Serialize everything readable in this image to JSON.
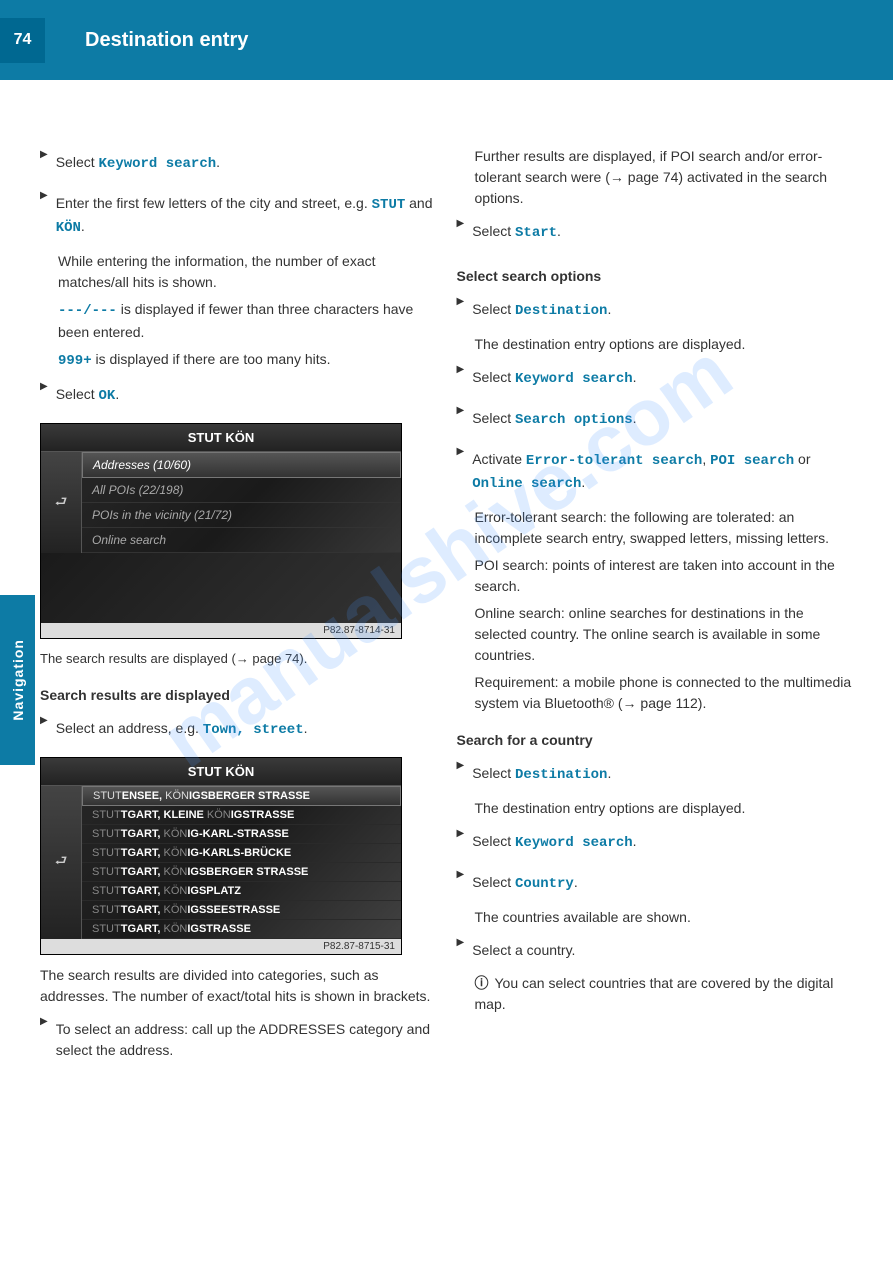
{
  "header": {
    "page_number": "74",
    "title": "Destination entry"
  },
  "side_tab": "Navigation",
  "watermark": "manualshive.com",
  "left": {
    "p1_a": "Select ",
    "p1_b": "Keyword search",
    "p1_c": ".",
    "p2_a": "Enter the first few letters of the city and street, e.g. ",
    "p2_b": "STUT",
    "p2_c": " and ",
    "p2_d": "KÖN",
    "p2_e": ".",
    "p3": "While entering the information, the number of exact matches/all hits is shown.",
    "p4_a": "---/---",
    "p4_b": " is displayed if fewer than three characters have been entered.",
    "p5_a": "999+",
    "p5_b": " is displayed if there are too many hits.",
    "p6_a": "Select ",
    "p6_b": "OK",
    "p6_c": ".",
    "caption1": "The search results are displayed (→ page 74).",
    "section1": "Search results are displayed",
    "caption2_a": "Select an address, e.g. ",
    "caption2_b": "Town, street",
    "caption2_c": "."
  },
  "right": {
    "p1": "Further results are displayed, if POI search and/or error-tolerant search were (→ page 74) activated in the search options.",
    "p2_a": "Select ",
    "p2_b": "Start",
    "p2_c": ".",
    "section2": "Select search options",
    "s2p1_a": "Select ",
    "s2p1_b": "Destination",
    "s2p1_c": ".",
    "s2p2": "The destination entry options are displayed.",
    "s2p3_a": "Select ",
    "s2p3_b": "Keyword search",
    "s2p3_c": ".",
    "s2p4_a": "Select ",
    "s2p4_b": "Search options",
    "s2p4_c": ".",
    "s2p5_a": "Activate ",
    "s2p5_b": "Error-tolerant search",
    "s2p5_c": "POI search",
    "s2p5_d": "Online search",
    "s2p5_e": ", ",
    "s2p5_f": " or ",
    "s2p5_g": ".",
    "s2p6": "Error-tolerant search: the following are tolerated: an incomplete search entry, swapped letters, missing letters.",
    "s2p7": "POI search: points of interest are taken into account in the search.",
    "s2p8": "Online search: online searches for destinations in the selected country. The online search is available in some countries.",
    "s2p9": "Requirement: a mobile phone is connected to the multimedia system via Bluetooth® (→ page 112).",
    "section3": "Search for a country",
    "s3p1_a": "Select ",
    "s3p1_b": "Destination",
    "s3p1_c": ".",
    "s3p2": "The destination entry options are displayed.",
    "s3p3_a": "Select ",
    "s3p3_b": "Keyword search",
    "s3p3_c": ".",
    "s3p4_a": "Select ",
    "s3p4_b": "Country",
    "s3p4_c": ".",
    "s3p5": "The countries available are shown.",
    "s3p6": "Select a country.",
    "s3p7": "You can select countries that are covered by the digital map."
  },
  "bottom": {
    "p1": "The search results are divided into categories, such as addresses. The number of exact/total hits is shown in brackets.",
    "p2": "To select an address: call up the ADDRESSES category and select the address."
  },
  "screenshot1": {
    "title": "STUT KÖN",
    "rows": [
      "Addresses (10/60)",
      "All POIs (22/198)",
      "POIs in the vicinity (21/72)",
      "Online search"
    ],
    "footer": "P82.87-8714-31"
  },
  "screenshot2": {
    "title": "STUT KÖN",
    "rows": [
      {
        "pre": "STUT",
        "mid": "ENSEE, KÖN",
        "post": "IGSBERGER STRASSE"
      },
      {
        "pre": "STUT",
        "mid": "TGART, KLEINE KÖN",
        "post": "IGSTRASSE"
      },
      {
        "pre": "STUT",
        "mid": "TGART, KÖN",
        "post": "IG-KARL-STRASSE"
      },
      {
        "pre": "STUT",
        "mid": "TGART, KÖN",
        "post": "IG-KARLS-BRÜCKE"
      },
      {
        "pre": "STUT",
        "mid": "TGART, KÖN",
        "post": "IGSBERGER STRASSE"
      },
      {
        "pre": "STUT",
        "mid": "TGART, KÖN",
        "post": "IGSPLATZ"
      },
      {
        "pre": "STUT",
        "mid": "TGART, KÖN",
        "post": "IGSSEESTRASSE"
      },
      {
        "pre": "STUT",
        "mid": "TGART, KÖN",
        "post": "IGSTRASSE"
      }
    ],
    "footer": "P82.87-8715-31"
  }
}
